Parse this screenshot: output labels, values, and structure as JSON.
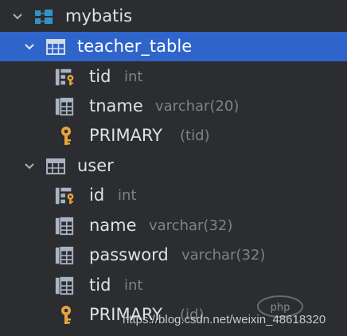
{
  "tree": {
    "database": {
      "label": "mybatis",
      "icon": "database-schema-icon",
      "expanded": true
    },
    "tables": [
      {
        "label": "teacher_table",
        "icon": "table-icon",
        "expanded": true,
        "selected": true,
        "children": [
          {
            "label": "tid",
            "type": "int",
            "icon": "primary-key-column-icon"
          },
          {
            "label": "tname",
            "type": "varchar(20)",
            "icon": "column-icon"
          },
          {
            "label": "PRIMARY",
            "type": "(tid)",
            "icon": "key-icon"
          }
        ]
      },
      {
        "label": "user",
        "icon": "table-icon",
        "expanded": true,
        "selected": false,
        "children": [
          {
            "label": "id",
            "type": "int",
            "icon": "primary-key-column-icon"
          },
          {
            "label": "name",
            "type": "varchar(32)",
            "icon": "column-icon"
          },
          {
            "label": "password",
            "type": "varchar(32)",
            "icon": "column-icon"
          },
          {
            "label": "tid",
            "type": "int",
            "icon": "column-icon"
          },
          {
            "label": "PRIMARY",
            "type": "(id)",
            "icon": "key-icon"
          }
        ]
      }
    ]
  },
  "colors": {
    "background": "#2b2d30",
    "selection": "#2f65ca",
    "text": "#dfe1e5",
    "type_text": "#7e8288",
    "table_icon": "#a8b4c4",
    "database_icon": "#3592c4",
    "key_icon": "#e8a33d"
  },
  "watermark": {
    "logo": "php中文网",
    "text": "https://blog.csdn.net/weixin_48618320"
  }
}
